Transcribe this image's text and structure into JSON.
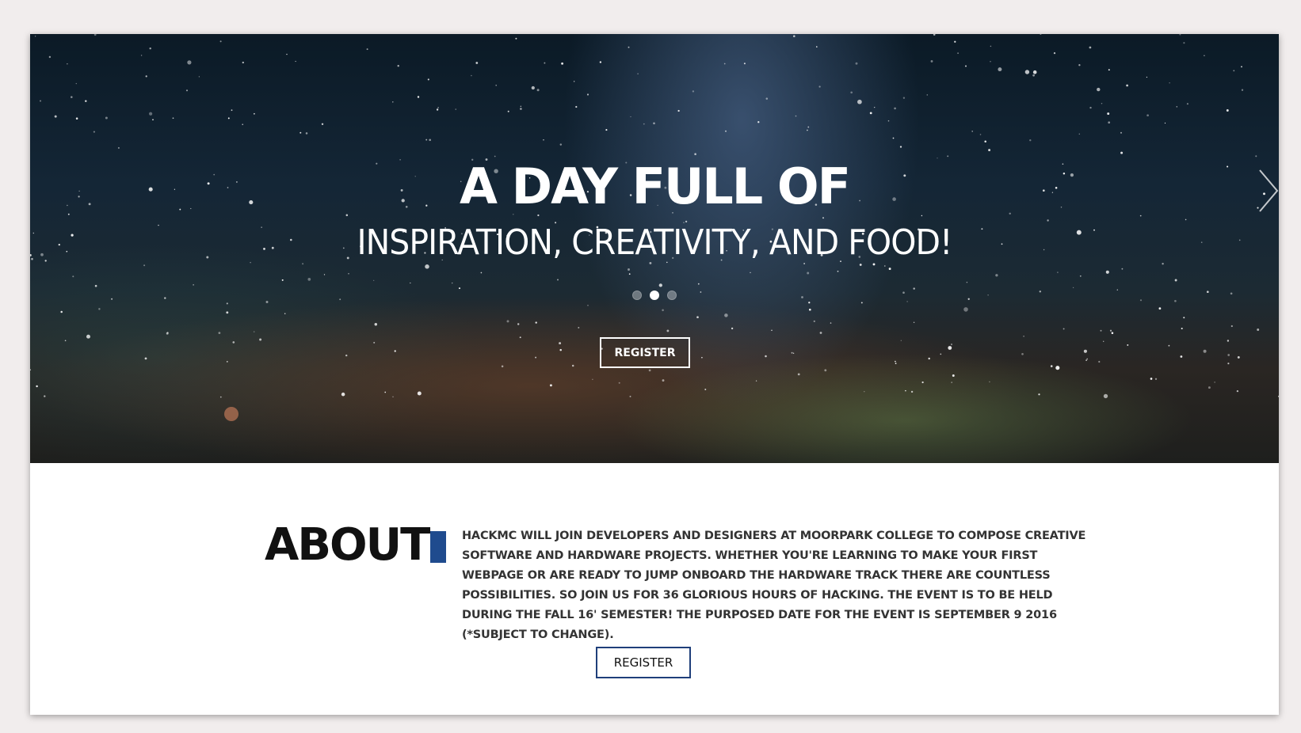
{
  "hero": {
    "title": "A DAY FULL OF",
    "subtitle": "INSPIRATION, CREATIVITY, AND FOOD!",
    "register_label": "REGISTER",
    "slide_count": 3,
    "active_slide": 2,
    "next_icon": "chevron-right-icon"
  },
  "about": {
    "heading": "ABOUT",
    "text": "HACKMC WILL JOIN DEVELOPERS AND DESIGNERS AT MOORPARK COLLEGE TO COMPOSE CREATIVE SOFTWARE AND HARDWARE PROJECTS. WHETHER YOU'RE LEARNING TO MAKE YOUR FIRST WEBPAGE OR ARE READY TO JUMP ONBOARD THE HARDWARE TRACK THERE ARE COUNTLESS POSSIBILITIES. SO JOIN US FOR 36 GLORIOUS HOURS OF HACKING. THE EVENT IS TO BE HELD DURING THE FALL 16' SEMESTER! THE PURPOSED DATE FOR THE EVENT IS SEPTEMBER 9 2016 (*SUBJECT TO CHANGE).",
    "register_label": "REGISTER",
    "accent_color": "#1f4b8e"
  }
}
